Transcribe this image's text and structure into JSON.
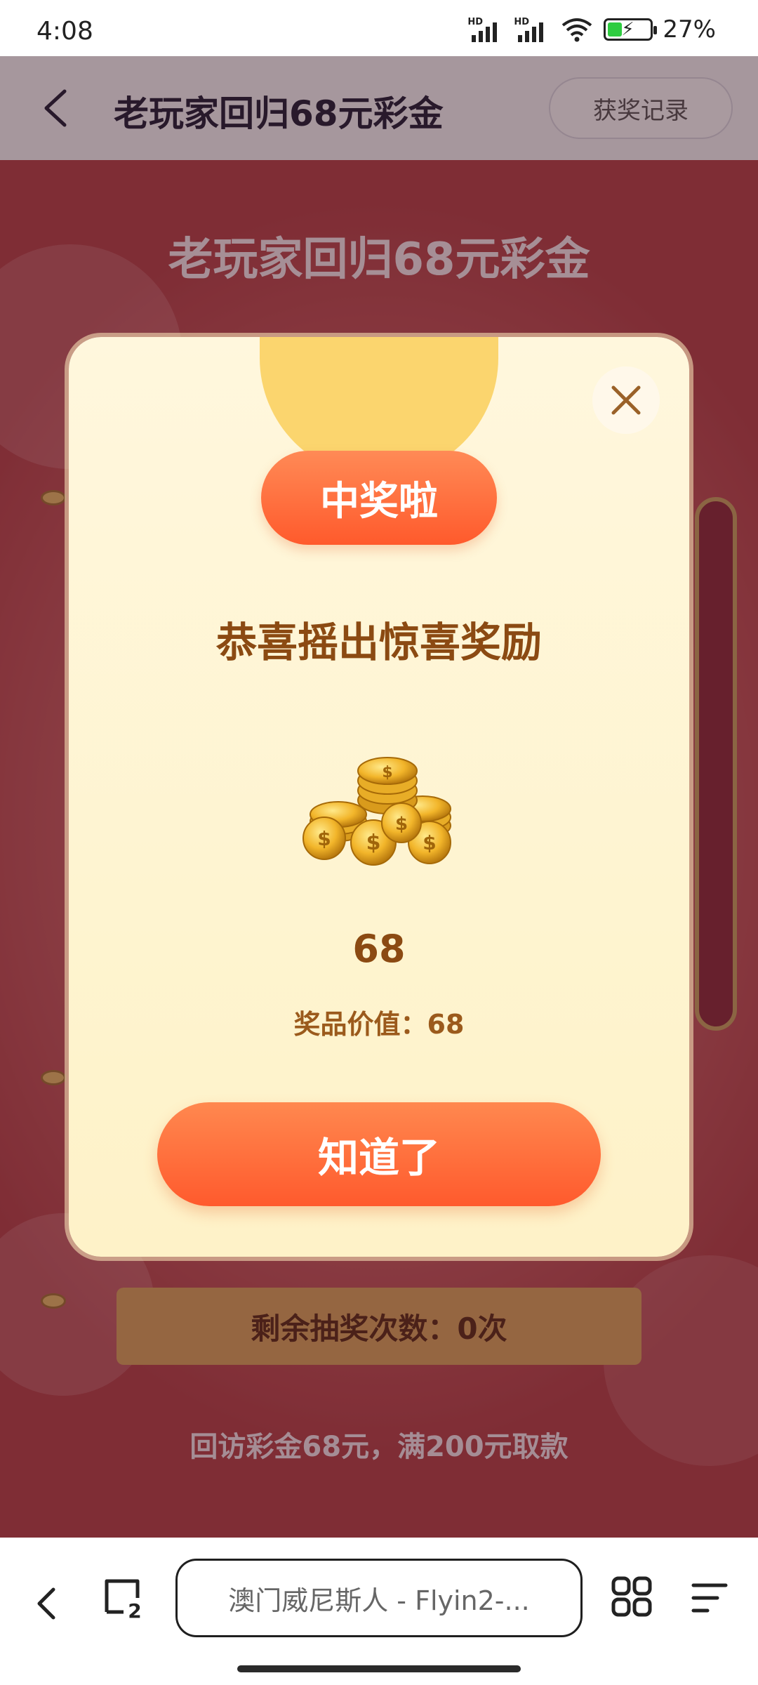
{
  "status_bar": {
    "time": "4:08",
    "signal1_label": "HD",
    "signal2_label": "HD",
    "battery_percent": "27%",
    "icons": [
      "signal-icon",
      "signal-icon",
      "wifi-icon",
      "battery-charging-icon"
    ]
  },
  "header": {
    "title": "老玩家回归68元彩金",
    "record_button": "获奖记录",
    "back_icon": "back-arrow-icon"
  },
  "page": {
    "title": "老玩家回归68元彩金",
    "remaining_draws": "剩余抽奖次数：0次",
    "note": "回访彩金68元，满200元取款"
  },
  "modal": {
    "badge": "中奖啦",
    "heading": "恭喜摇出惊喜奖励",
    "prize_image": "gold-coins-icon",
    "prize_amount": "68",
    "prize_value": "奖品价值：68",
    "ok_button": "知道了",
    "close_icon": "close-icon"
  },
  "browser": {
    "url_text": "澳门威尼斯人 - Flyin2-...",
    "tab_count": "2",
    "icons": [
      "back-arrow-icon",
      "tabs-icon",
      "apps-grid-icon",
      "menu-icon"
    ]
  },
  "colors": {
    "accent": "#ff6a3a",
    "modal_bg": "#fff4d2",
    "heading_brown": "#8b4a12"
  }
}
